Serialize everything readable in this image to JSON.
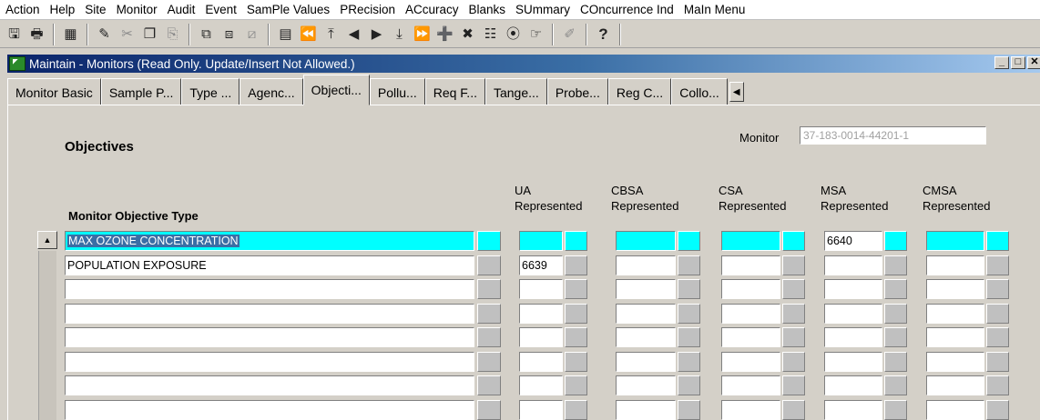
{
  "menu": [
    "Action",
    "Help",
    "Site",
    "Monitor",
    "Audit",
    "Event",
    "SamPle Values",
    "PRecision",
    "ACcuracy",
    "Blanks",
    "SUmmary",
    "COncurrence Ind",
    "MaIn Menu"
  ],
  "toolbar_icons": [
    "save-icon",
    "print-icon",
    "exit-icon",
    "edit-icon",
    "cut-icon",
    "copy-icon",
    "paste-icon",
    "insert-record-icon",
    "duplicate-record-icon",
    "delete-record-icon",
    "clear-icon",
    "first-record-icon",
    "top-icon",
    "previous-record-icon",
    "next-record-icon",
    "down-icon",
    "last-record-icon",
    "add-icon",
    "remove-icon",
    "block-icon",
    "lov-icon",
    "query-icon",
    "editor-icon",
    "help-icon"
  ],
  "window": {
    "title": "Maintain - Monitors (Read Only. Update/Insert Not Allowed.)"
  },
  "tabs": [
    "Monitor Basic",
    "Sample P...",
    "Type ...",
    "Agenc...",
    "Objecti...",
    "Pollu...",
    "Req F...",
    "Tange...",
    "Probe...",
    "Reg C...",
    "Collo..."
  ],
  "active_tab": 4,
  "form": {
    "section_title": "Objectives",
    "monitor_label": "Monitor",
    "monitor_value": "37-183-0014-44201-1",
    "headers": {
      "objective_type": "Monitor Objective Type",
      "ua_line1": "UA",
      "ua_line2": "Represented",
      "cbsa_line1": "CBSA",
      "cbsa_line2": "Represented",
      "csa_line1": "CSA",
      "csa_line2": "Represented",
      "msa_line1": "MSA",
      "msa_line2": "Represented",
      "cmsa_line1": "CMSA",
      "cmsa_line2": "Represented"
    },
    "rows": [
      {
        "objective": "MAX OZONE CONCENTRATION",
        "ua": "",
        "cbsa": "",
        "csa": "",
        "msa": "6640",
        "cmsa": ""
      },
      {
        "objective": "POPULATION EXPOSURE",
        "ua": "6639",
        "cbsa": "",
        "csa": "",
        "msa": "",
        "cmsa": ""
      },
      {
        "objective": "",
        "ua": "",
        "cbsa": "",
        "csa": "",
        "msa": "",
        "cmsa": ""
      },
      {
        "objective": "",
        "ua": "",
        "cbsa": "",
        "csa": "",
        "msa": "",
        "cmsa": ""
      },
      {
        "objective": "",
        "ua": "",
        "cbsa": "",
        "csa": "",
        "msa": "",
        "cmsa": ""
      },
      {
        "objective": "",
        "ua": "",
        "cbsa": "",
        "csa": "",
        "msa": "",
        "cmsa": ""
      },
      {
        "objective": "",
        "ua": "",
        "cbsa": "",
        "csa": "",
        "msa": "",
        "cmsa": ""
      },
      {
        "objective": "",
        "ua": "",
        "cbsa": "",
        "csa": "",
        "msa": "",
        "cmsa": ""
      }
    ],
    "selected_row": 0
  },
  "colors": {
    "selection": "#00ffff",
    "title_start": "#0a246a",
    "title_end": "#a6caf0"
  }
}
